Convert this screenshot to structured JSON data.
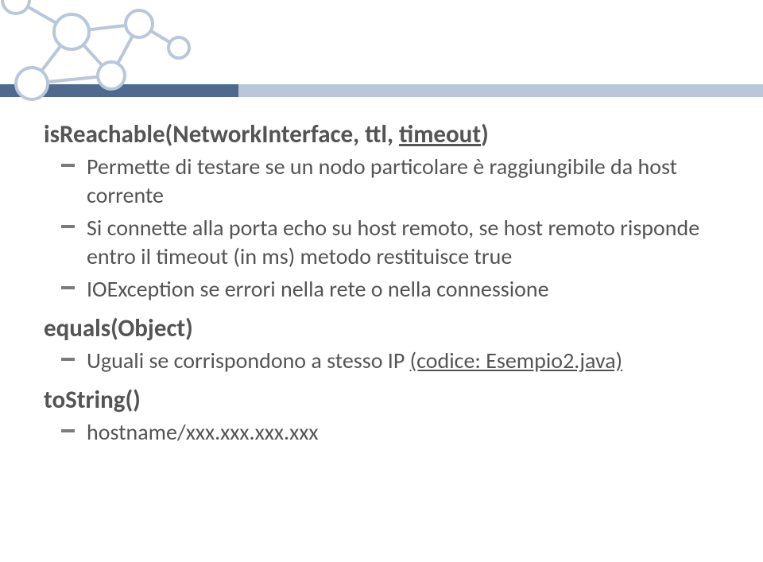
{
  "slide": {
    "methods": [
      {
        "name_prefix": "isReachable(NetworkInterface, ttl, ",
        "name_underlined": "timeout",
        "name_suffix": ")",
        "bullets": [
          {
            "text": "Permette di testare se un nodo particolare è raggiungibile da host corrente"
          },
          {
            "text": "Si connette alla porta echo su host remoto, se host remoto risponde entro il timeout (in ms) metodo restituisce true"
          },
          {
            "text": "IOException se errori nella rete o nella connessione"
          }
        ]
      },
      {
        "name_prefix": "equals(Object)",
        "name_underlined": "",
        "name_suffix": "",
        "bullets": [
          {
            "text_before": "Uguali se corrispondono a stesso IP ",
            "link": "(codice: Esempio2.java)"
          }
        ]
      },
      {
        "name_prefix": "toString()",
        "name_underlined": "",
        "name_suffix": "",
        "bullets": [
          {
            "text": "hostname/xxx.xxx.xxx.xxx"
          }
        ]
      }
    ]
  }
}
